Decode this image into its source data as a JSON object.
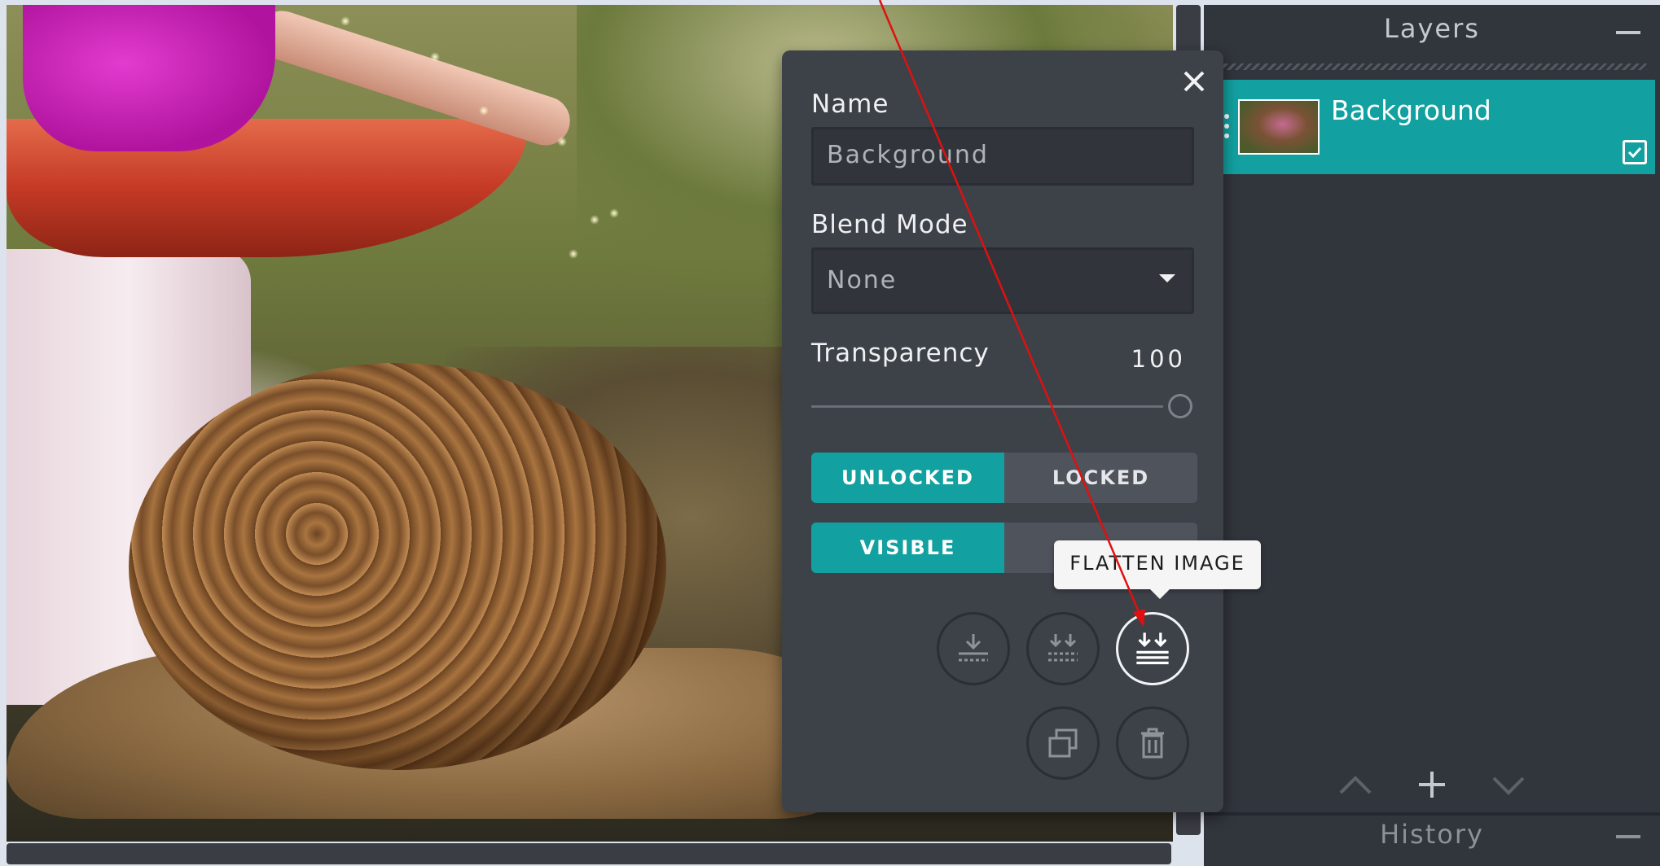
{
  "layers_panel": {
    "title": "Layers",
    "collapse_icon": "minus-icon",
    "layers": [
      {
        "name": "Background",
        "visible_checked": true,
        "selected": true
      }
    ],
    "nav_icons": [
      "chevron-up-icon",
      "plus-icon",
      "chevron-down-icon"
    ]
  },
  "history_panel": {
    "title": "History",
    "collapse_icon": "minus-icon"
  },
  "layer_properties": {
    "name_label": "Name",
    "name_value": "Background",
    "blend_label": "Blend Mode",
    "blend_value": "None",
    "transparency_label": "Transparency",
    "transparency_value": "100",
    "lock_options": {
      "unlocked": "UNLOCKED",
      "locked": "LOCKED",
      "selected": "UNLOCKED"
    },
    "visibility_options": {
      "visible": "VISIBLE",
      "selected": "VISIBLE"
    },
    "actions_row1": [
      "merge-down-icon",
      "merge-visible-icon",
      "flatten-image-icon"
    ],
    "actions_row2": [
      "duplicate-layer-icon",
      "delete-layer-icon"
    ]
  },
  "tooltip": {
    "text": "FLATTEN IMAGE"
  },
  "colors": {
    "accent": "#13a0a0",
    "panel_bg": "#31353c",
    "popup_bg": "#3d4148",
    "annotation": "#e01010"
  }
}
